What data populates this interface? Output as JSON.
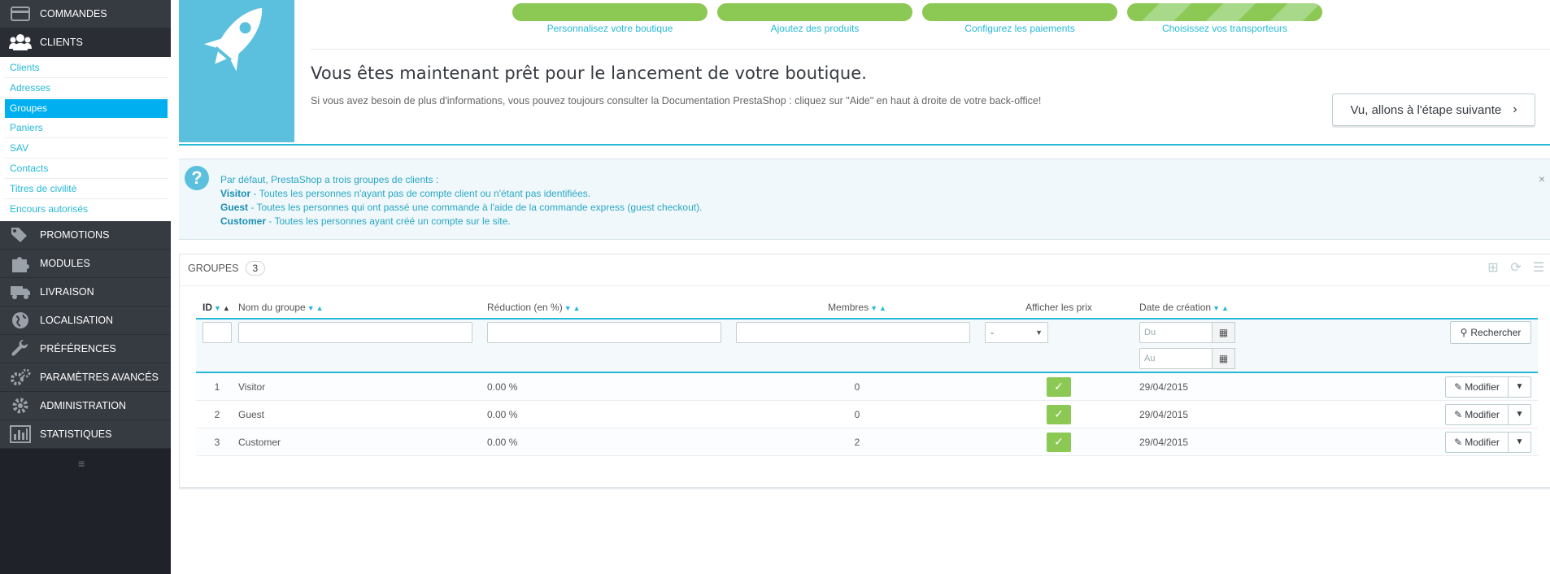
{
  "sidebar": {
    "top_item": {
      "label": "COMMANDES",
      "icon": "credit-card-icon"
    },
    "active_item": {
      "label": "CLIENTS",
      "icon": "users-icon"
    },
    "sub_items": [
      "Clients",
      "Adresses",
      "Groupes",
      "Paniers",
      "SAV",
      "Contacts",
      "Titres de civilité",
      "Encours autorisés"
    ],
    "active_sub": "Groupes",
    "items": [
      {
        "label": "PROMOTIONS",
        "icon": "tags-icon"
      },
      {
        "label": "MODULES",
        "icon": "puzzle-icon"
      },
      {
        "label": "LIVRAISON",
        "icon": "truck-icon"
      },
      {
        "label": "LOCALISATION",
        "icon": "globe-icon"
      },
      {
        "label": "PRÉFÉRENCES",
        "icon": "wrench-icon"
      },
      {
        "label": "PARAMÈTRES AVANCÉS",
        "icon": "gears-icon"
      },
      {
        "label": "ADMINISTRATION",
        "icon": "gear-icon"
      },
      {
        "label": "STATISTIQUES",
        "icon": "bar-chart-icon"
      }
    ],
    "collapse_icon": "menu-collapse-icon"
  },
  "onboarding": {
    "steps": [
      "Personnalisez votre boutique",
      "Ajoutez des produits",
      "Configurez les paiements",
      "Choisissez vos transporteurs"
    ],
    "title": "Vous êtes maintenant prêt pour le lancement de votre boutique.",
    "text": "Si vous avez besoin de plus d'informations, vous pouvez toujours consulter la Documentation PrestaShop : cliquez sur \"Aide\" en haut à droite de votre back-office!",
    "next_button": "Vu, allons à l'étape suivante",
    "colors": {
      "progress": "#8bc954",
      "panel": "#5bc0de"
    }
  },
  "info": {
    "intro": "Par défaut, PrestaShop a trois groupes de clients :",
    "lines": [
      {
        "name": "Visitor",
        "text": " - Toutes les personnes n'ayant pas de compte client ou n'étant pas identifiées."
      },
      {
        "name": "Guest",
        "text": " - Toutes les personnes qui ont passé une commande à l'aide de la commande express (guest checkout)."
      },
      {
        "name": "Customer",
        "text": " - Toutes les personnes ayant créé un compte sur le site."
      }
    ],
    "close": "×"
  },
  "groups": {
    "title": "GROUPES",
    "count": "3",
    "columns": {
      "id": "ID",
      "name": "Nom du groupe",
      "reduction": "Réduction (en %)",
      "members": "Membres",
      "show_prices": "Afficher les prix",
      "date": "Date de création"
    },
    "filters": {
      "select_value": "-",
      "date_from_placeholder": "Du",
      "date_to_placeholder": "Au",
      "search_button": "Rechercher"
    },
    "rows": [
      {
        "id": "1",
        "name": "Visitor",
        "reduction": "0.00 %",
        "members": "0",
        "show_prices": true,
        "date": "29/04/2015",
        "action": "Modifier"
      },
      {
        "id": "2",
        "name": "Guest",
        "reduction": "0.00 %",
        "members": "0",
        "show_prices": true,
        "date": "29/04/2015",
        "action": "Modifier"
      },
      {
        "id": "3",
        "name": "Customer",
        "reduction": "0.00 %",
        "members": "2",
        "show_prices": true,
        "date": "29/04/2015",
        "action": "Modifier"
      }
    ]
  }
}
